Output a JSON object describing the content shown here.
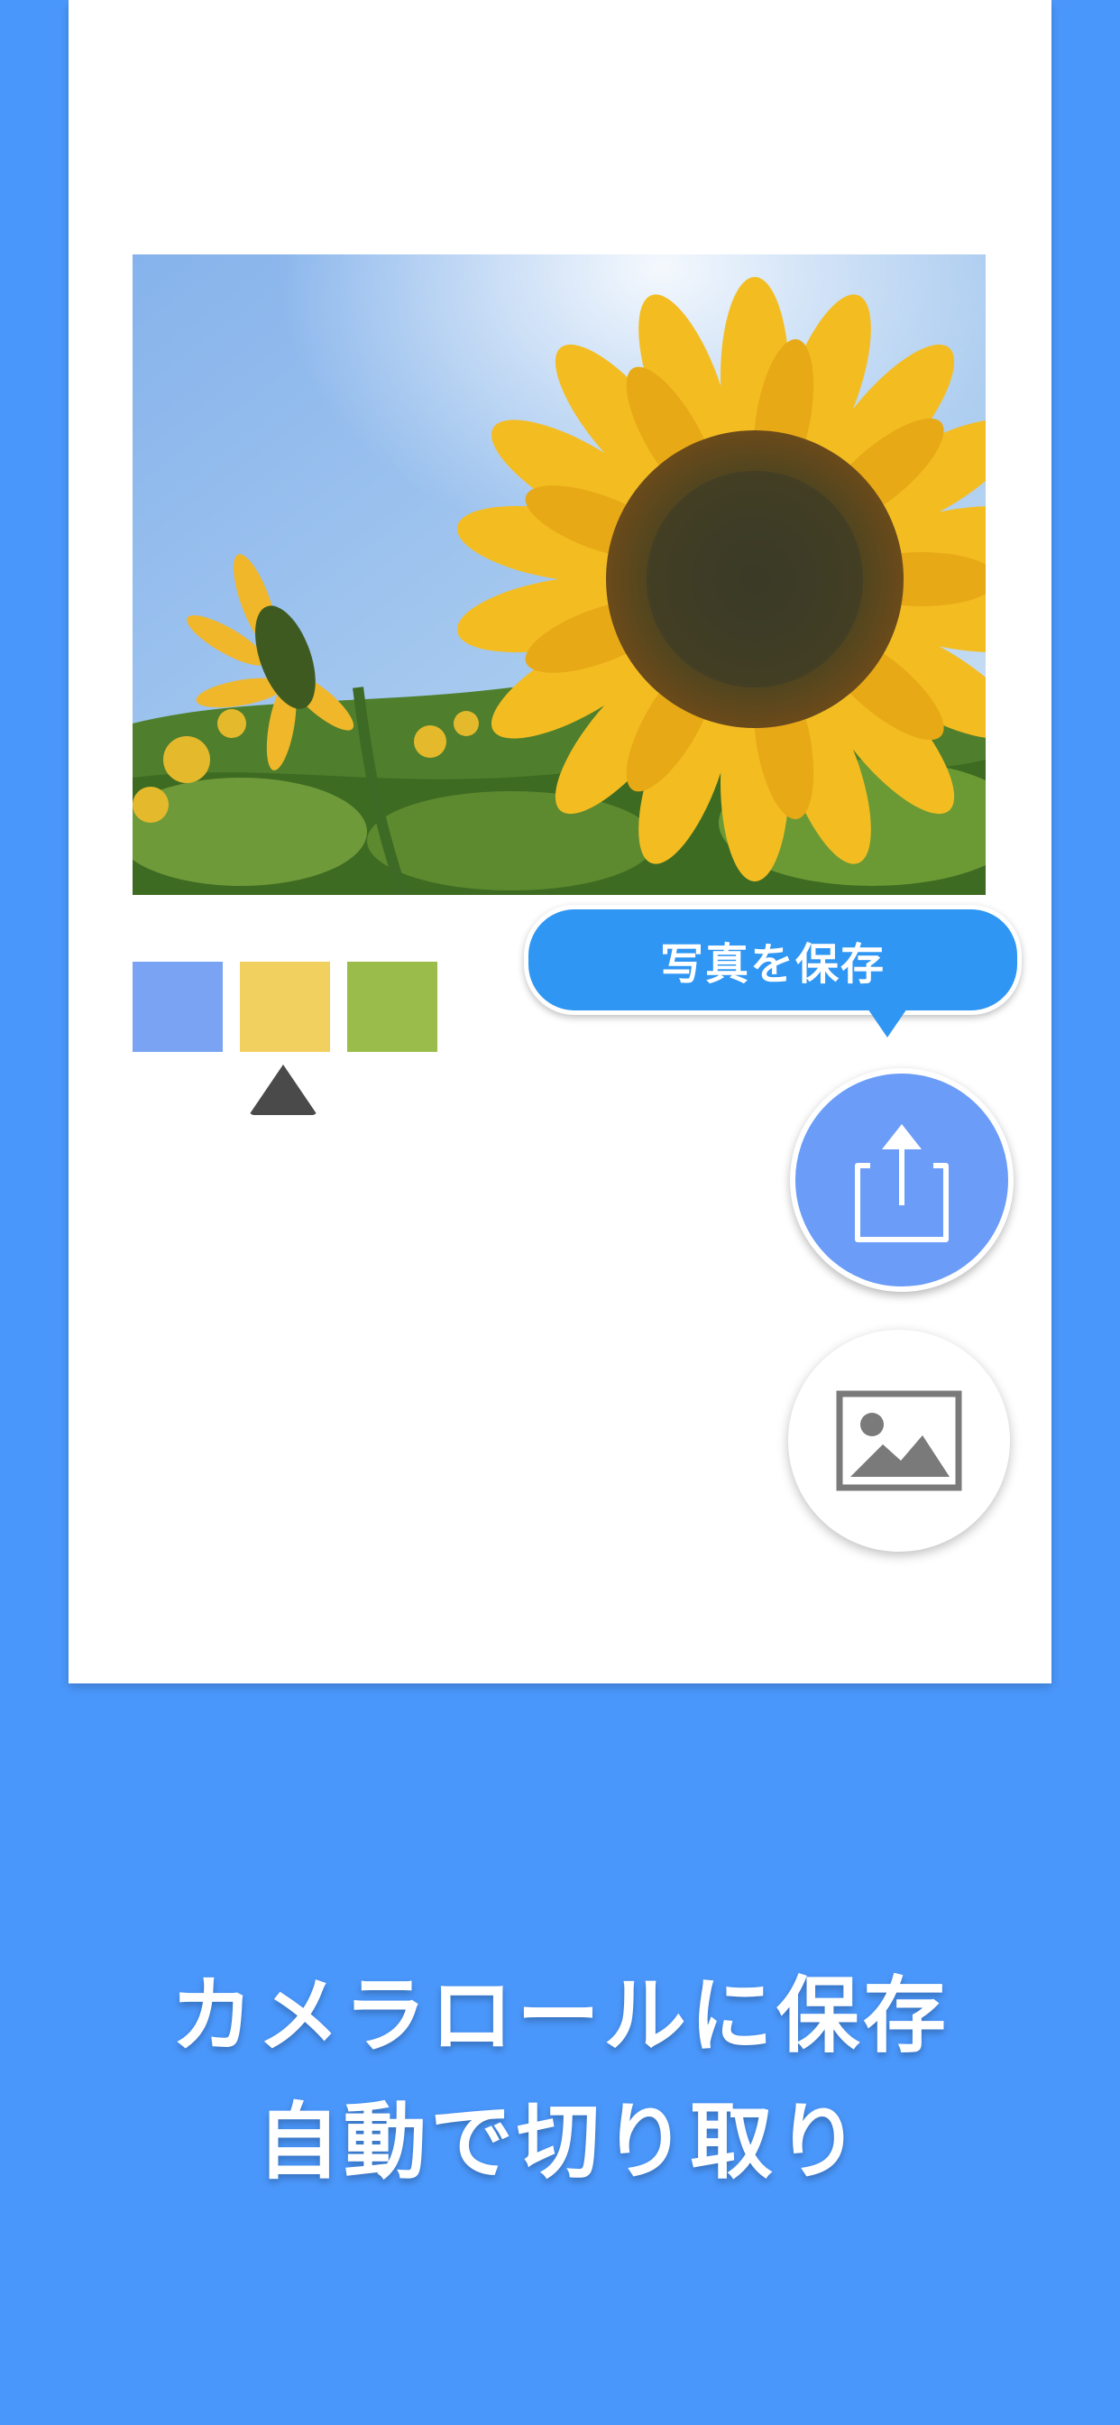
{
  "editor": {
    "swatch_colors": [
      "#7aa4f3",
      "#f2d060",
      "#9abc4a"
    ],
    "selected_swatch_index": 1,
    "tooltip": "写真を保存",
    "actions": [
      {
        "name": "share",
        "icon": "share-icon"
      },
      {
        "name": "image",
        "icon": "image-icon"
      }
    ]
  },
  "caption": {
    "line1": "カメラロールに保存",
    "line2": "自動で切り取り"
  }
}
